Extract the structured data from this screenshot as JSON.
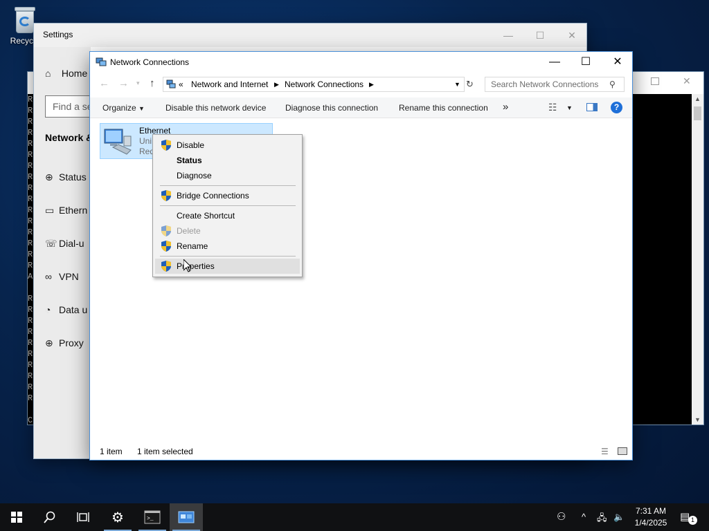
{
  "desktop": {
    "recycle_label": "Recycle"
  },
  "settings": {
    "title": "Settings",
    "home_label": "Home",
    "search_placeholder": "Find a se",
    "section_title": "Network &",
    "nav": [
      {
        "label": "Status",
        "icon": "globe-icon"
      },
      {
        "label": "Ethern",
        "icon": "ethernet-icon"
      },
      {
        "label": "Dial-u",
        "icon": "dialup-icon"
      },
      {
        "label": "VPN",
        "icon": "vpn-icon"
      },
      {
        "label": "Data u",
        "icon": "data-usage-icon"
      },
      {
        "label": "Proxy",
        "icon": "proxy-globe-icon"
      }
    ]
  },
  "terminal": {
    "letters": [
      "R",
      "R",
      "R",
      "R",
      "R",
      "R",
      "R",
      "R",
      "R",
      "R",
      "R",
      "R",
      "R",
      "R",
      "R",
      "R",
      "A",
      "",
      "R",
      "R",
      "R",
      "R",
      "R",
      "R",
      "R",
      "R",
      "R",
      "R",
      "",
      "C"
    ]
  },
  "netwin": {
    "title": "Network Connections",
    "address": {
      "prefix": "«",
      "crumbs": [
        "Network and Internet",
        "Network Connections"
      ]
    },
    "search_placeholder": "Search Network Connections",
    "commands": {
      "organize": "Organize",
      "disable": "Disable this network device",
      "diagnose": "Diagnose this connection",
      "rename": "Rename this connection",
      "more": "»"
    },
    "item": {
      "name": "Ethernet",
      "line2": "Uni",
      "line3": "Red"
    },
    "status": {
      "count": "1 item",
      "selected": "1 item selected"
    }
  },
  "context_menu": {
    "items": [
      {
        "label": "Disable",
        "shield": true,
        "bold": false,
        "disabled": false
      },
      {
        "label": "Status",
        "shield": false,
        "bold": true,
        "disabled": false
      },
      {
        "label": "Diagnose",
        "shield": false,
        "bold": false,
        "disabled": false
      },
      {
        "label": "Bridge Connections",
        "shield": true,
        "bold": false,
        "disabled": false
      },
      {
        "label": "Create Shortcut",
        "shield": false,
        "bold": false,
        "disabled": false
      },
      {
        "label": "Delete",
        "shield": true,
        "bold": false,
        "disabled": true
      },
      {
        "label": "Rename",
        "shield": true,
        "bold": false,
        "disabled": false
      },
      {
        "label": "Properties",
        "shield": true,
        "bold": false,
        "disabled": false,
        "highlighted": true
      }
    ]
  },
  "taskbar": {
    "time": "7:31 AM",
    "date": "1/4/2025",
    "notification_count": "1"
  },
  "colors": {
    "selection": "#cce8ff",
    "accent": "#0078d7",
    "help": "#1e6fd8"
  }
}
